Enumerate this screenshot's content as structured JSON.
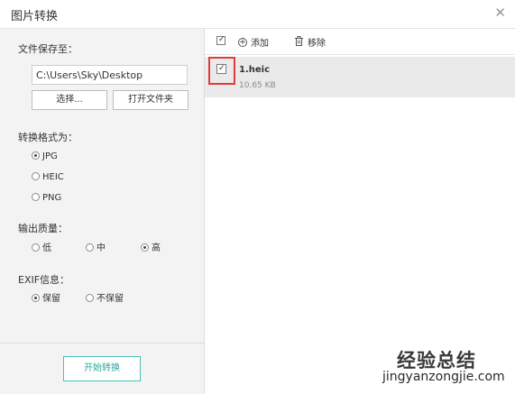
{
  "window": {
    "title": "图片转换"
  },
  "left": {
    "save_label": "文件保存至：",
    "path_value": "C:\\Users\\Sky\\Desktop",
    "select_btn": "选择...",
    "open_folder_btn": "打开文件夹",
    "format_label": "转换格式为：",
    "formats": [
      {
        "label": "JPG",
        "selected": true
      },
      {
        "label": "HEIC",
        "selected": false
      },
      {
        "label": "PNG",
        "selected": false
      }
    ],
    "quality_label": "输出质量：",
    "qualities": [
      {
        "label": "低",
        "selected": false
      },
      {
        "label": "中",
        "selected": false
      },
      {
        "label": "高",
        "selected": true
      }
    ],
    "exif_label": "EXIF信息：",
    "exif_options": [
      {
        "label": "保留",
        "selected": true
      },
      {
        "label": "不保留",
        "selected": false
      }
    ],
    "start_btn": "开始转换"
  },
  "right": {
    "add_label": "添加",
    "remove_label": "移除",
    "files": [
      {
        "name": "1.heic",
        "size": "10.65 KB",
        "checked": true
      }
    ]
  },
  "watermark": {
    "line1": "经验总结",
    "line2": "jingyanzongjie.com"
  },
  "colors": {
    "accent": "#2aa89d",
    "highlight": "#e23b3b",
    "left_panel_bg": "#f3f3f3",
    "row_bg": "#eaeaea"
  }
}
